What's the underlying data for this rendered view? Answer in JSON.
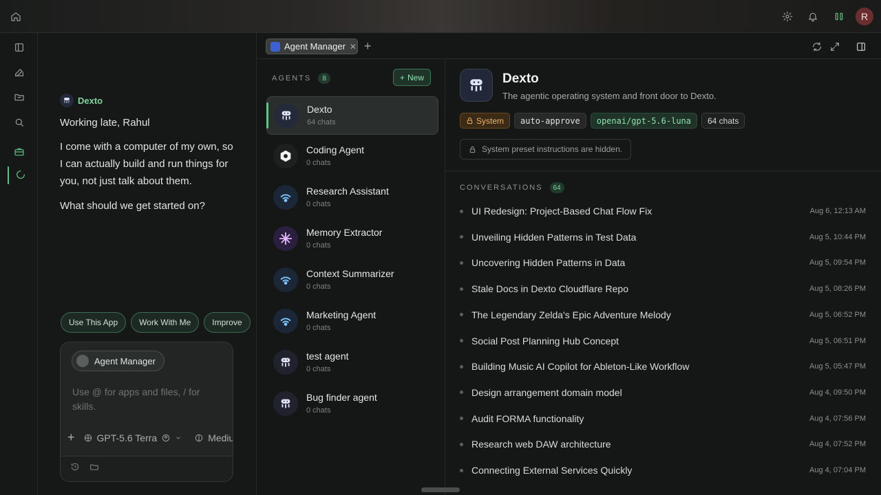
{
  "topbar": {
    "icons": [
      "home-icon",
      "gear-icon",
      "bell-icon",
      "columns-icon"
    ],
    "avatar_initial": "R"
  },
  "rail": {
    "icons": [
      "sidebar-toggle-icon",
      "compose-icon",
      "folder-icon",
      "search-icon",
      "briefcase-icon",
      "spinner-icon"
    ]
  },
  "chat": {
    "agent_name": "Dexto",
    "greeting": "Working late, Rahul",
    "message": "I come with a computer of my own, so I can actually build and run things for you, not just talk about them.",
    "question": "What should we get started on?",
    "chips": [
      "Use This App",
      "Work With Me",
      "Improve"
    ],
    "composer": {
      "context_pill": "Agent Manager",
      "placeholder": "Use @ for apps and files, / for skills.",
      "model": "GPT-5.6 Terra",
      "effort": "Medium"
    }
  },
  "tabs": [
    {
      "label": "Agent Manager"
    }
  ],
  "agents": {
    "heading": "AGENTS",
    "count": "8",
    "new_label": "New",
    "items": [
      {
        "name": "Dexto",
        "sub": "64 chats",
        "selected": true,
        "logo": "dexto-logo-icon",
        "bg": "#252a3a"
      },
      {
        "name": "Coding Agent",
        "sub": "0 chats",
        "logo": "hexagon-icon",
        "bg": "#1e2020"
      },
      {
        "name": "Research Assistant",
        "sub": "0 chats",
        "logo": "signal-icon",
        "bg": "#1b2636"
      },
      {
        "name": "Memory Extractor",
        "sub": "0 chats",
        "logo": "spark-icon",
        "bg": "#2a1f3e"
      },
      {
        "name": "Context Summarizer",
        "sub": "0 chats",
        "logo": "signal-icon",
        "bg": "#1b2636"
      },
      {
        "name": "Marketing Agent",
        "sub": "0 chats",
        "logo": "signal-icon",
        "bg": "#1b2636"
      },
      {
        "name": "test agent",
        "sub": "0 chats",
        "logo": "dexto-logo-icon",
        "bg": "#20232e"
      },
      {
        "name": "Bug finder agent",
        "sub": "0 chats",
        "logo": "dexto-logo-icon",
        "bg": "#20232e"
      }
    ]
  },
  "detail": {
    "title": "Dexto",
    "description": "The agentic operating system and front door to Dexto.",
    "tags": {
      "system": "System",
      "approve": "auto-approve",
      "model": "openai/gpt-5.6-luna",
      "chats": "64 chats"
    },
    "note": "System preset instructions are hidden.",
    "conversations_heading": "CONVERSATIONS",
    "conversations_count": "64",
    "conversations": [
      {
        "title": "UI Redesign: Project-Based Chat Flow Fix",
        "time": "Aug 6, 12:13 AM"
      },
      {
        "title": "Unveiling Hidden Patterns in Test Data",
        "time": "Aug 5, 10:44 PM"
      },
      {
        "title": "Uncovering Hidden Patterns in Data",
        "time": "Aug 5, 09:54 PM"
      },
      {
        "title": "Stale Docs in Dexto Cloudflare Repo",
        "time": "Aug 5, 08:26 PM"
      },
      {
        "title": "The Legendary Zelda's Epic Adventure Melody",
        "time": "Aug 5, 06:52 PM"
      },
      {
        "title": "Social Post Planning Hub Concept",
        "time": "Aug 5, 06:51 PM"
      },
      {
        "title": "Building Music AI Copilot for Ableton-Like Workflow",
        "time": "Aug 5, 05:47 PM"
      },
      {
        "title": "Design arrangement domain model",
        "time": "Aug 4, 09:50 PM"
      },
      {
        "title": "Audit FORMA functionality",
        "time": "Aug 4, 07:56 PM"
      },
      {
        "title": "Research web DAW architecture",
        "time": "Aug 4, 07:52 PM"
      },
      {
        "title": "Connecting External Services Quickly",
        "time": "Aug 4, 07:04 PM"
      }
    ]
  }
}
